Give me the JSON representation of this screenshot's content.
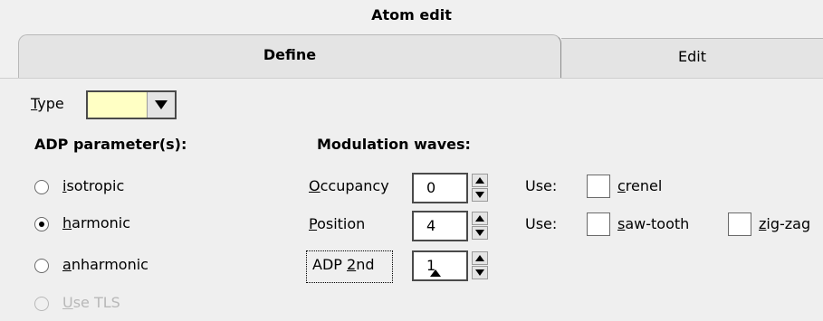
{
  "window": {
    "title": "Atom edit"
  },
  "tabs": [
    {
      "label": "Define"
    },
    {
      "label": "Edit"
    }
  ],
  "type_select": {
    "label_u": "T",
    "label_rest": "ype",
    "value": "",
    "bg_color": "#ffffc4"
  },
  "adp": {
    "heading": "ADP parameter(s):",
    "options": [
      {
        "u": "i",
        "rest": "sotropic",
        "selected": false
      },
      {
        "u": "h",
        "rest": "armonic",
        "selected": true
      },
      {
        "u": "a",
        "rest": "nharmonic",
        "selected": false
      },
      {
        "u": "U",
        "rest": "se TLS",
        "selected": false,
        "disabled": true
      }
    ]
  },
  "modulation": {
    "heading": "Modulation waves:",
    "occupancy": {
      "u": "O",
      "rest": "ccupancy",
      "value": "0",
      "use_label": "Use:",
      "check_u": "c",
      "check_rest": "renel"
    },
    "position": {
      "u": "P",
      "rest": "osition",
      "value": "4",
      "use_label": "Use:",
      "check1_u": "s",
      "check1_rest": "aw-tooth",
      "check2_u": "z",
      "check2_rest": "ig-zag"
    },
    "adp2": {
      "pre": "ADP ",
      "u": "2",
      "rest": "nd",
      "value": "1"
    }
  }
}
